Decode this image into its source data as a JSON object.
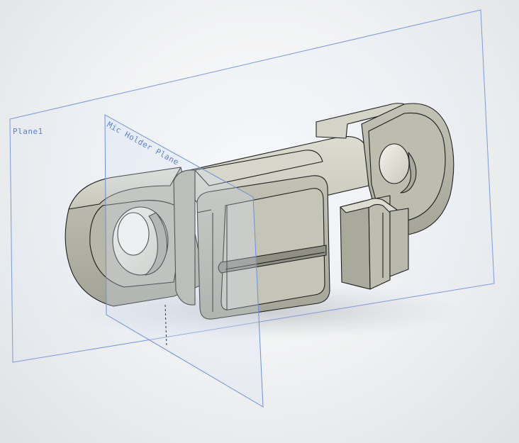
{
  "viewport": {
    "background": "#eef0f1",
    "part_color": "#c9c9bd",
    "part_edge_color": "#1a1a1a",
    "plane_color": "#6f8fd8"
  },
  "planes": [
    {
      "id": "plane1",
      "label": "Plane1"
    },
    {
      "id": "mic-holder-plane",
      "label": "Mic Holder Plane"
    }
  ],
  "part": {
    "icon": "3d-part-icon"
  }
}
